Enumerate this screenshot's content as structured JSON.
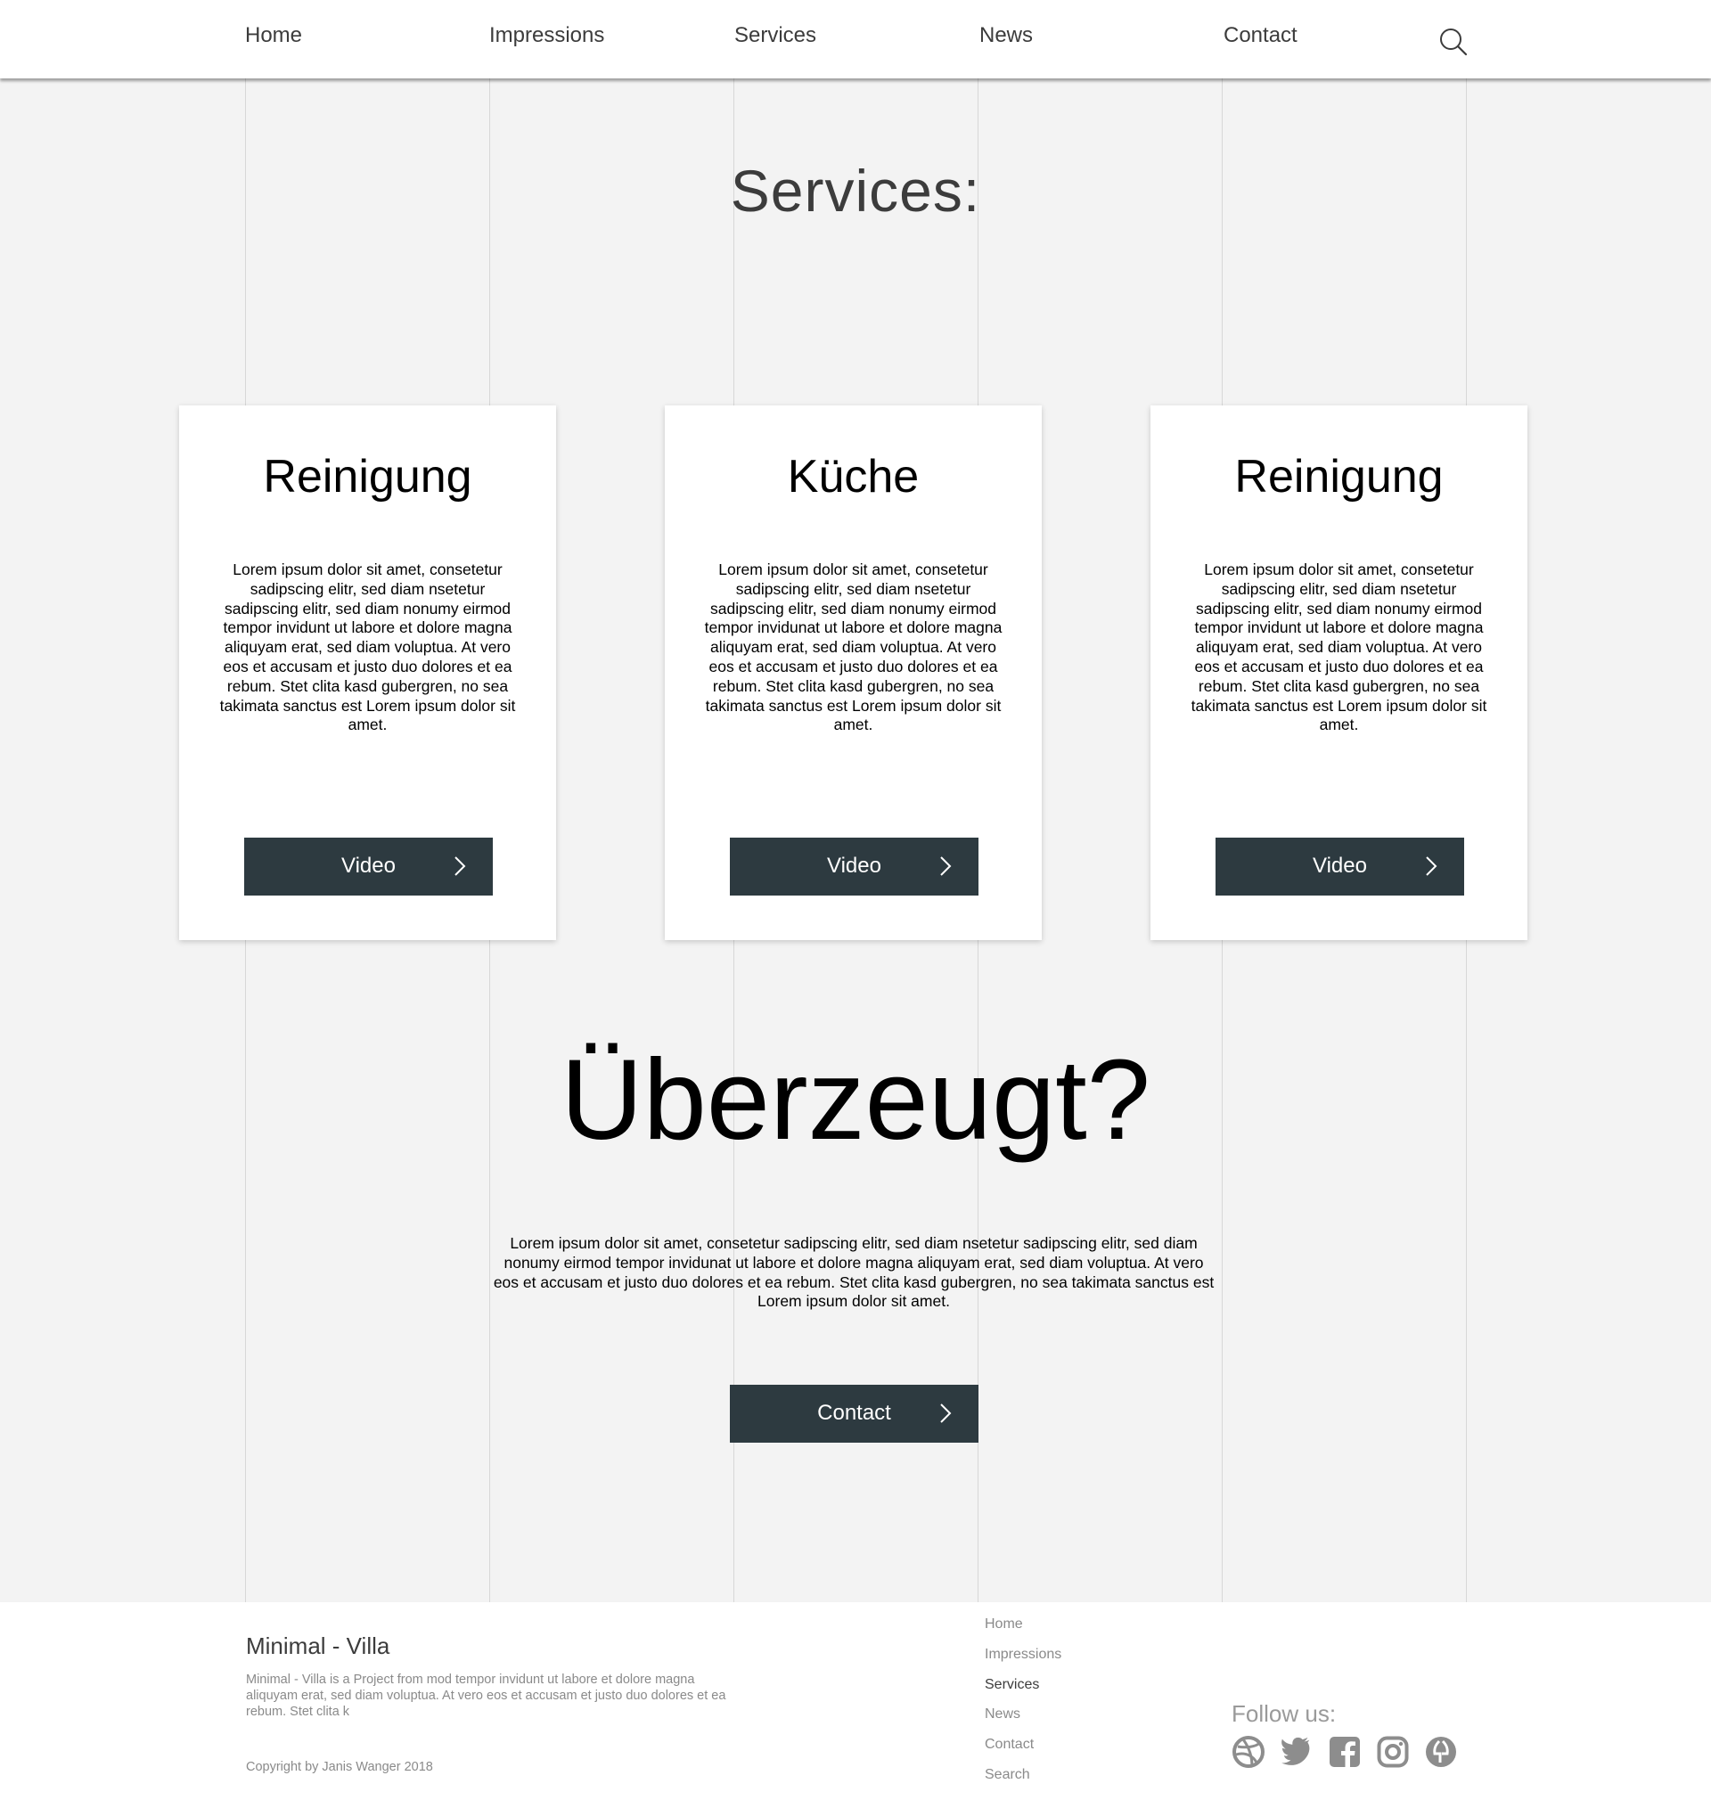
{
  "nav": {
    "items": [
      {
        "label": "Home"
      },
      {
        "label": "Impressions"
      },
      {
        "label": "Services"
      },
      {
        "label": "News"
      },
      {
        "label": "Contact"
      }
    ],
    "search_icon": "search-icon"
  },
  "page": {
    "title": "Services:"
  },
  "cards": [
    {
      "title": "Reinigung",
      "text": "Lorem ipsum dolor sit amet, consetetur sadipscing elitr, sed diam nsetetur sadipscing elitr, sed diam nonumy eirmod tempor invidunt ut labore et dolore magna aliquyam erat, sed diam voluptua. At vero eos et accusam et justo duo dolores et ea rebum. Stet clita kasd gubergren, no sea takimata sanctus est Lorem ipsum dolor sit amet.",
      "button": "Video"
    },
    {
      "title": "Küche",
      "text": "Lorem ipsum dolor sit amet, consetetur sadipscing elitr, sed diam nsetetur sadipscing elitr, sed diam nonumy eirmod tempor invidunat ut labore et dolore magna aliquyam erat, sed diam voluptua. At vero eos et accusam et justo duo dolores et ea rebum. Stet clita kasd gubergren, no sea takimata sanctus est Lorem ipsum dolor sit amet.",
      "button": "Video"
    },
    {
      "title": "Reinigung",
      "text": "Lorem ipsum dolor sit amet, consetetur sadipscing elitr, sed diam nsetetur sadipscing elitr, sed diam nonumy eirmod tempor invidunt ut labore et dolore magna aliquyam erat, sed diam voluptua. At vero eos et accusam et justo duo dolores et ea rebum. Stet clita kasd gubergren, no sea takimata sanctus est Lorem ipsum dolor sit amet.",
      "button": "Video"
    }
  ],
  "cta": {
    "title": "Überzeugt?",
    "text": "Lorem ipsum dolor sit amet, consetetur sadipscing elitr, sed diam nsetetur sadipscing elitr, sed diam nonumy eirmod tempor invidunat ut labore et dolore magna aliquyam erat, sed diam voluptua. At vero eos et accusam et justo duo dolores et ea rebum. Stet clita kasd gubergren, no sea takimata sanctus est Lorem ipsum dolor sit amet.",
    "button": "Contact"
  },
  "footer": {
    "brand": "Minimal - Villa",
    "description": "Minimal - Villa  is a Project from mod tempor invidunt ut labore et dolore magna aliquyam erat, sed diam voluptua. At vero eos et accusam et justo duo dolores et ea rebum. Stet clita k",
    "copyright": "Copyright by Janis Wanger 2018",
    "links": [
      {
        "label": "Home"
      },
      {
        "label": "Impressions"
      },
      {
        "label": "Services",
        "active": true
      },
      {
        "label": "News"
      },
      {
        "label": "Contact"
      },
      {
        "label": "Search"
      }
    ],
    "follow_label": "Follow us:",
    "social_icons": [
      "dribbble-icon",
      "twitter-icon",
      "facebook-icon",
      "instagram-icon",
      "behance-icon"
    ]
  },
  "colors": {
    "background": "#f3f3f3",
    "button": "#2d3a40",
    "heading": "#3c3c3c",
    "footer_text": "#8a8a8a",
    "social_icon": "#8d8d8d"
  }
}
